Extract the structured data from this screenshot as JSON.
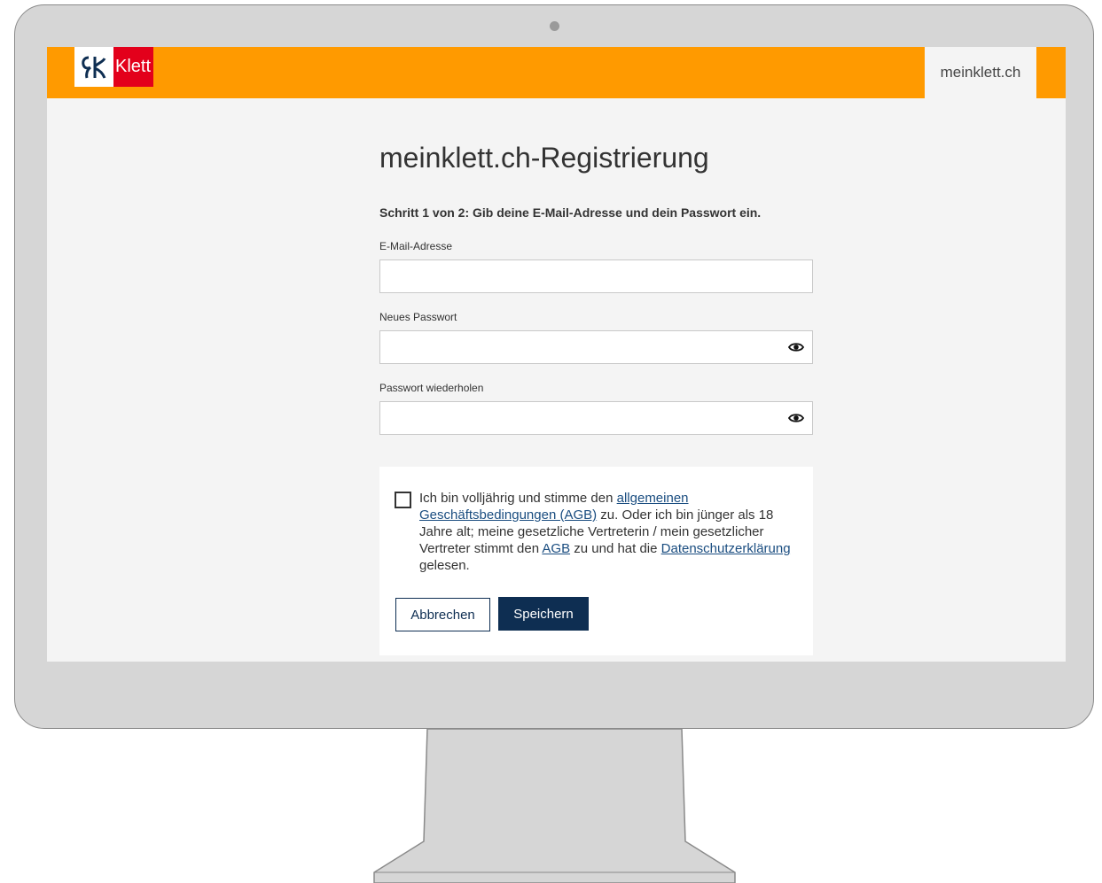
{
  "header": {
    "logo_text": "Klett",
    "site_name": "meinklett.ch"
  },
  "page": {
    "title": "meinklett.ch-Registrierung",
    "step": "Schritt 1 von 2: Gib deine E-Mail-Adresse und dein Passwort ein."
  },
  "form": {
    "email_label": "E-Mail-Adresse",
    "email_value": "",
    "new_password_label": "Neues Passwort",
    "new_password_value": "",
    "repeat_password_label": "Passwort wiederholen",
    "repeat_password_value": "",
    "toggle_icon": "eye-icon"
  },
  "consent": {
    "checked": false,
    "text_1": "Ich bin volljährig und stimme den ",
    "link_agb_full": "allgemeinen Geschäftsbedingungen (AGB)",
    "text_2": " zu. Oder ich bin jünger als 18 Jahre alt; meine gesetzliche Vertreterin / mein gesetzlicher Vertreter stimmt den ",
    "link_agb": "AGB",
    "text_3": " zu und hat die ",
    "link_privacy": "Datenschutzerklärung",
    "text_4": " gelesen."
  },
  "actions": {
    "cancel_label": "Abbrechen",
    "save_label": "Speichern"
  },
  "colors": {
    "header_orange": "#ff9a00",
    "klett_red": "#e3001b",
    "primary_navy": "#0e2e52",
    "link_blue": "#1a4d80"
  }
}
